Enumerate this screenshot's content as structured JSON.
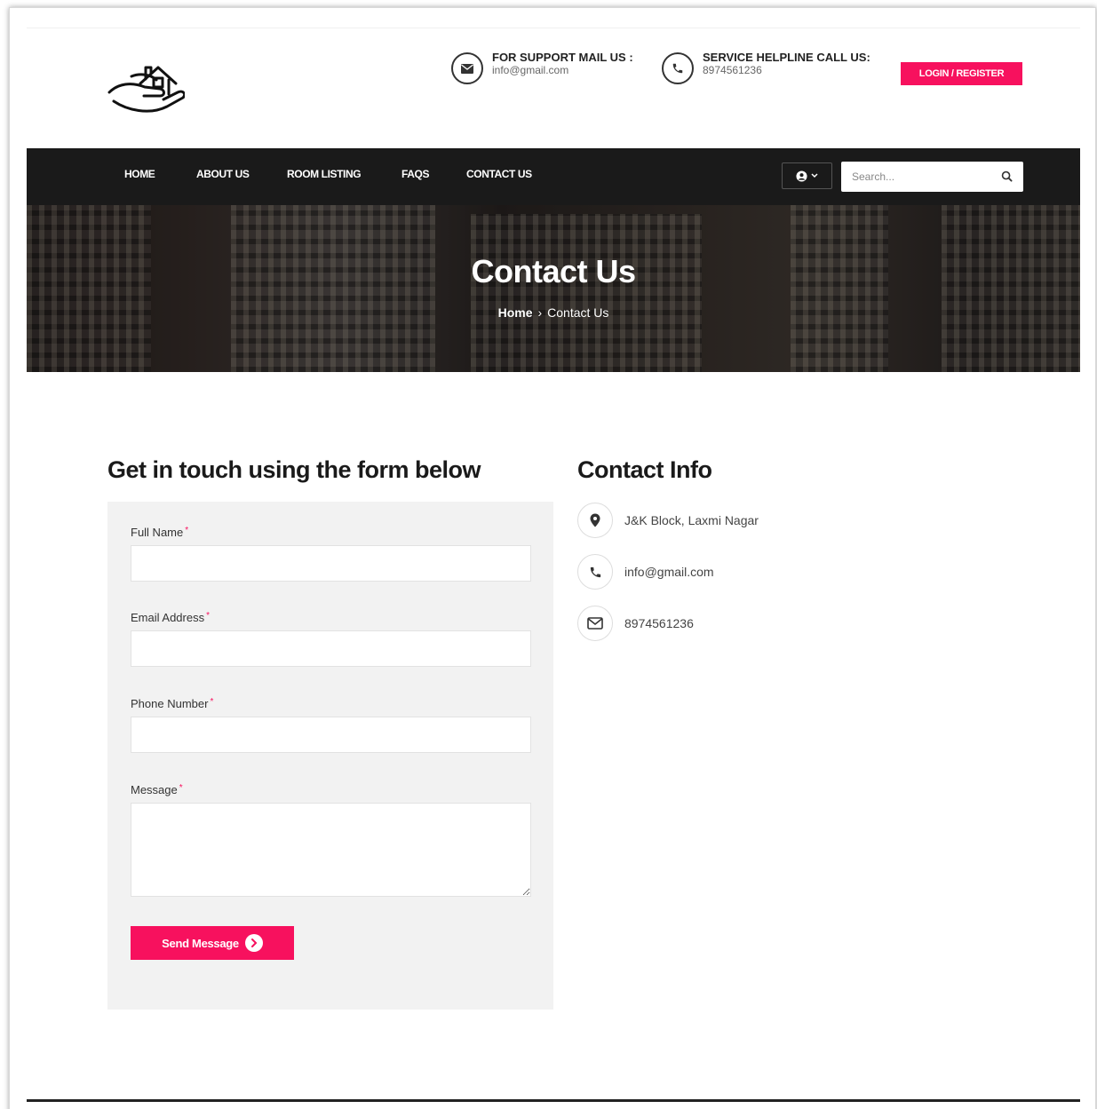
{
  "header": {
    "support_label": "FOR SUPPORT MAIL US :",
    "support_value": "info@gmail.com",
    "helpline_label": "SERVICE HELPLINE CALL US:",
    "helpline_value": "8974561236",
    "login_label": "LOGIN / REGISTER"
  },
  "nav": {
    "items": [
      "HOME",
      "ABOUT US",
      "ROOM LISTING",
      "FAQS",
      "CONTACT US"
    ],
    "search_placeholder": "Search..."
  },
  "hero": {
    "title": "Contact Us",
    "breadcrumb_home": "Home",
    "breadcrumb_sep": "›",
    "breadcrumb_current": "Contact Us"
  },
  "form": {
    "title": "Get in touch using the form below",
    "full_name_label": "Full Name",
    "email_label": "Email Address",
    "phone_label": "Phone Number",
    "message_label": "Message",
    "required_mark": "*",
    "send_label": "Send Message"
  },
  "info": {
    "title": "Contact Info",
    "address": "J&K Block, Laxmi Nagar",
    "email": "info@gmail.com",
    "phone": "8974561236"
  },
  "colors": {
    "accent": "#f7115e",
    "navbar": "#1a1a1a",
    "panel": "#f2f2f2"
  },
  "icons": {
    "logo": "house-in-hand-icon",
    "support": "envelope-icon",
    "helpline": "phone-icon",
    "user": "user-icon",
    "search": "search-icon",
    "address": "map-pin-icon",
    "info_email": "phone-icon",
    "info_phone": "envelope-icon",
    "send": "chevron-right-icon"
  }
}
